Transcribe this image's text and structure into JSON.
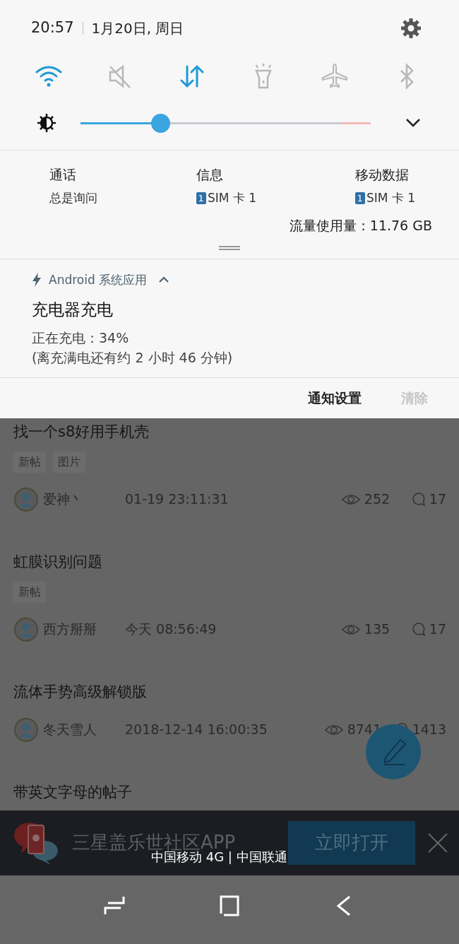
{
  "header": {
    "time": "20:57",
    "date": "1月20日, 周日"
  },
  "toggles": [
    {
      "kind": "wifi",
      "on": true
    },
    {
      "kind": "sound",
      "on": false
    },
    {
      "kind": "data",
      "on": true
    },
    {
      "kind": "flashlight",
      "on": false
    },
    {
      "kind": "airplane",
      "on": false
    },
    {
      "kind": "bluetooth",
      "on": false
    }
  ],
  "brightness": {
    "level": 0.26
  },
  "sim_settings": [
    {
      "label": "通话",
      "value": "总是询问"
    },
    {
      "label": "信息",
      "sim": "1",
      "value": "SIM 卡 1"
    },
    {
      "label": "移动数据",
      "sim": "1",
      "value": "SIM 卡 1"
    }
  ],
  "data_usage": "流量使用量：11.76 GB",
  "notification": {
    "app": "Android 系统应用",
    "title": "充电器充电",
    "lines": [
      "正在充电：34%",
      "(离充满电还有约 2 小时 46 分钟)"
    ]
  },
  "notification_actions": [
    {
      "label": "通知设置",
      "disabled": false
    },
    {
      "label": "清除",
      "disabled": true
    }
  ],
  "posts": [
    {
      "title": "找一个s8好用手机壳",
      "tags": [
        "新帖",
        "图片"
      ],
      "author": "爱神丶",
      "time": "01-19 23:11:31",
      "views": "252",
      "comments": "17"
    },
    {
      "title": "虹膜识别问题",
      "tags": [
        "新帖"
      ],
      "author": "西方掰掰",
      "time": "今天 08:56:49",
      "views": "135",
      "comments": "17"
    },
    {
      "title": "流体手势高级解锁版",
      "author": "冬天雪人",
      "time": "2018-12-14 16:00:35",
      "views": "8741",
      "comments": "1413"
    },
    {
      "title": "带英文字母的帖子"
    }
  ],
  "banner": {
    "title": "三星盖乐世社区APP",
    "button": "立即打开"
  },
  "carrier": "中国移动 4G | 中国联通"
}
